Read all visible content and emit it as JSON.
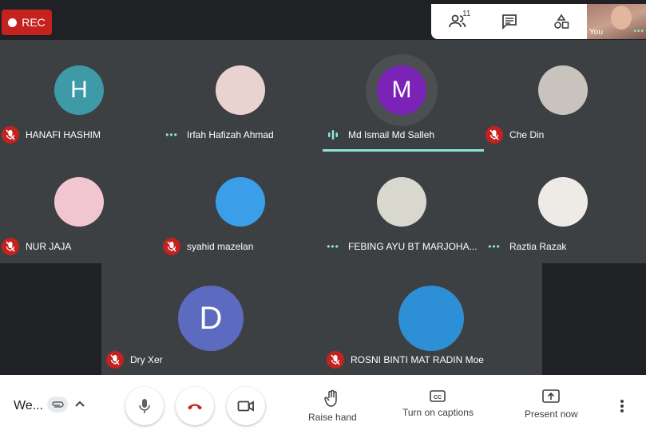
{
  "top": {
    "rec_label": "REC",
    "participant_count": "11",
    "self_label": "You"
  },
  "participants": [
    {
      "name": "HANAFI HASHIM",
      "initial": "H",
      "avatar_color": "#3e9aa7",
      "status": "muted"
    },
    {
      "name": "Irfah Hafizah Ahmad",
      "initial": "",
      "avatar_color": "#e9d3d0",
      "status": "dots"
    },
    {
      "name": "Md Ismail Md Salleh",
      "initial": "M",
      "avatar_color": "#7b22b7",
      "status": "speaking"
    },
    {
      "name": "Che Din",
      "initial": "",
      "avatar_color": "#c9c3bd",
      "status": "muted"
    },
    {
      "name": "NUR JAJA",
      "initial": "",
      "avatar_color": "#f2c6d0",
      "status": "muted"
    },
    {
      "name": "syahid mazelan",
      "initial": "",
      "avatar_color": "#3b9ee8",
      "status": "muted"
    },
    {
      "name": "FEBING AYU BT MARJOHA...",
      "initial": "",
      "avatar_color": "#d9d8cf",
      "status": "dots"
    },
    {
      "name": "Raztia Razak",
      "initial": "",
      "avatar_color": "#eeeae6",
      "status": "dots"
    },
    {
      "name": "Dry Xer",
      "initial": "D",
      "avatar_color": "#5c6bc0",
      "status": "muted"
    },
    {
      "name": "ROSNI BINTI MAT RADIN Moe",
      "initial": "",
      "avatar_color": "#2d8fd5",
      "status": "muted"
    }
  ],
  "bottom": {
    "meeting_title": "We...",
    "raise_hand": "Raise hand",
    "captions": "Turn on captions",
    "present": "Present now"
  },
  "colors": {
    "end_call": "#c5221f",
    "accent": "#8ce6d6",
    "muted": "#c5221f"
  }
}
